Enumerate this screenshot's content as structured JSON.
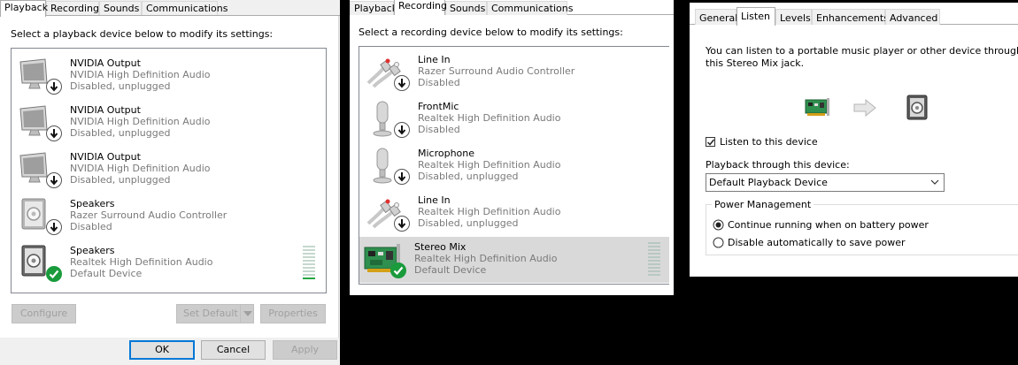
{
  "playback": {
    "tabs": [
      "Playback",
      "Recording",
      "Sounds",
      "Communications"
    ],
    "instruction": "Select a playback device below to modify its settings:",
    "devices": [
      {
        "name": "NVIDIA Output",
        "driver": "NVIDIA High Definition Audio",
        "status": "Disabled, unplugged",
        "icon": "monitor-icon"
      },
      {
        "name": "NVIDIA Output",
        "driver": "NVIDIA High Definition Audio",
        "status": "Disabled, unplugged",
        "icon": "monitor-icon"
      },
      {
        "name": "NVIDIA Output",
        "driver": "NVIDIA High Definition Audio",
        "status": "Disabled, unplugged",
        "icon": "monitor-icon"
      },
      {
        "name": "Speakers",
        "driver": "Razer Surround Audio Controller",
        "status": "Disabled",
        "icon": "speaker-icon"
      },
      {
        "name": "Speakers",
        "driver": "Realtek High Definition Audio",
        "status": "Default Device",
        "icon": "speaker-icon"
      }
    ],
    "buttons": {
      "configure": "Configure",
      "set_default": "Set Default",
      "properties": "Properties"
    },
    "footer": {
      "ok": "OK",
      "cancel": "Cancel",
      "apply": "Apply"
    }
  },
  "recording": {
    "tabs": [
      "Playback",
      "Recording",
      "Sounds",
      "Communications"
    ],
    "instruction": "Select a recording device below to modify its settings:",
    "devices": [
      {
        "name": "Line In",
        "driver": "Razer Surround Audio Controller",
        "status": "Disabled",
        "icon": "rca-cable-icon"
      },
      {
        "name": "FrontMic",
        "driver": "Realtek High Definition Audio",
        "status": "Disabled",
        "icon": "microphone-icon"
      },
      {
        "name": "Microphone",
        "driver": "Realtek High Definition Audio",
        "status": "Disabled, unplugged",
        "icon": "microphone-icon"
      },
      {
        "name": "Line In",
        "driver": "Realtek High Definition Audio",
        "status": "Disabled, unplugged",
        "icon": "rca-cable-icon"
      },
      {
        "name": "Stereo Mix",
        "driver": "Realtek High Definition Audio",
        "status": "Default Device",
        "icon": "sound-card-icon"
      }
    ]
  },
  "properties": {
    "tabs": [
      "General",
      "Listen",
      "Levels",
      "Enhancements",
      "Advanced"
    ],
    "description_line1": "You can listen to a portable music player or other device through",
    "description_line2": "this Stereo Mix jack.",
    "listen_label": "Listen to this device",
    "listen_checked": true,
    "playback_through_label": "Playback through this device:",
    "playback_device": "Default Playback Device",
    "power_group": "Power Management",
    "power_option1": "Continue running when on battery power",
    "power_option2": "Disable automatically to save power",
    "power_selected": 1
  },
  "colors": {
    "accent": "#0078d7",
    "check_green": "#1a9b3c",
    "meter_green": "#26a641",
    "selection": "#d9d9d9"
  }
}
